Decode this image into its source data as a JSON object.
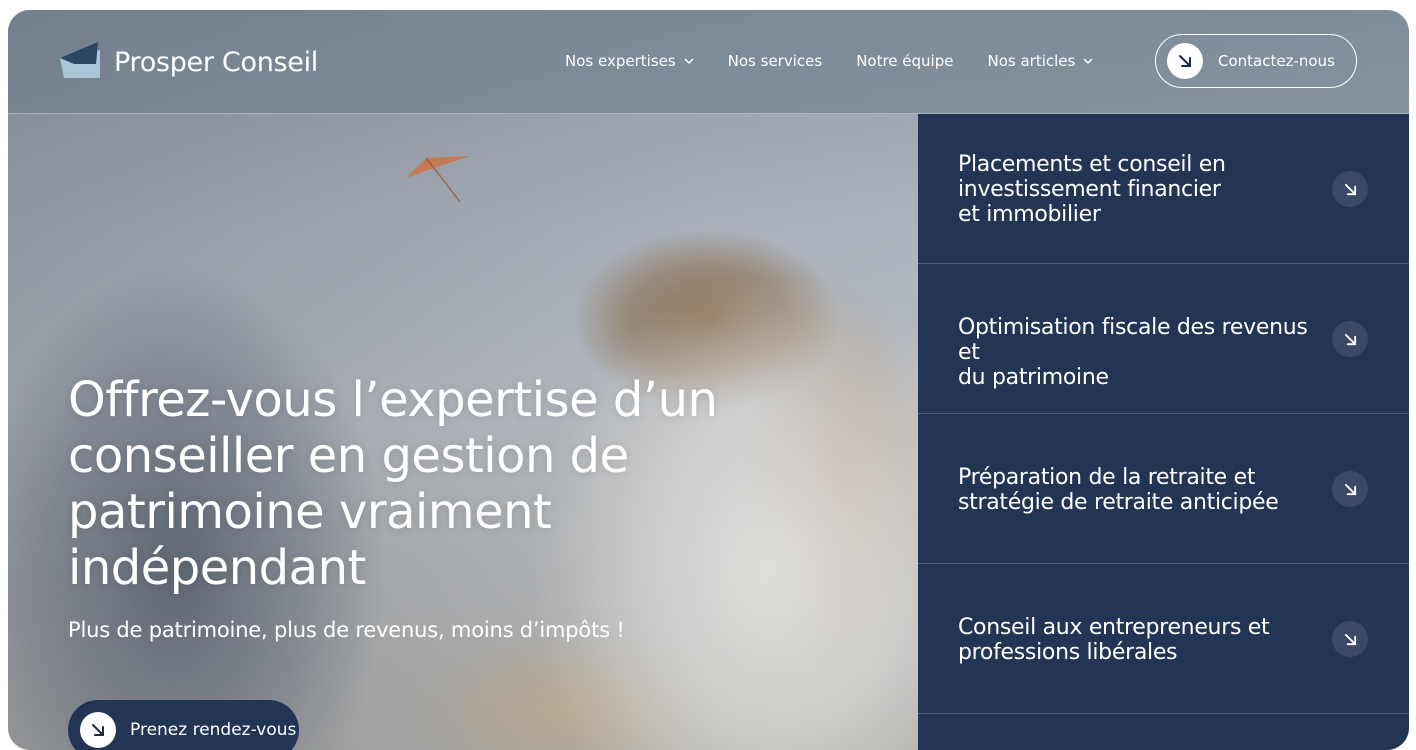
{
  "header": {
    "brand": "Prosper Conseil",
    "nav": [
      {
        "label": "Nos expertises",
        "has_dropdown": true
      },
      {
        "label": "Nos services",
        "has_dropdown": false
      },
      {
        "label": "Notre équipe",
        "has_dropdown": false
      },
      {
        "label": "Nos articles",
        "has_dropdown": true
      }
    ],
    "contact_label": "Contactez-nous"
  },
  "hero": {
    "title": "Offrez-vous l’expertise d’un conseiller en gestion de patrimoine vraiment indépendant",
    "subtitle": "Plus de patrimoine, plus de revenus, moins d’impôts !",
    "cta_label": "Prenez rendez-vous"
  },
  "expertises": [
    {
      "label": "Placements et conseil en\ninvestissement financier\net immobilier"
    },
    {
      "label": "Optimisation fiscale des revenus et\ndu patrimoine"
    },
    {
      "label": "Préparation de la retraite et\nstratégie de retraite anticipée"
    },
    {
      "label": "Conseil aux entrepreneurs et\nprofessions libérales"
    }
  ],
  "colors": {
    "navy": "#233554",
    "white": "#ffffff",
    "logo_dark": "#2c4763",
    "logo_light": "#a9c6d6"
  },
  "icons": {
    "logo": "folder-logo-icon",
    "dropdown": "chevron-down-icon",
    "arrow": "arrow-down-right-icon"
  }
}
